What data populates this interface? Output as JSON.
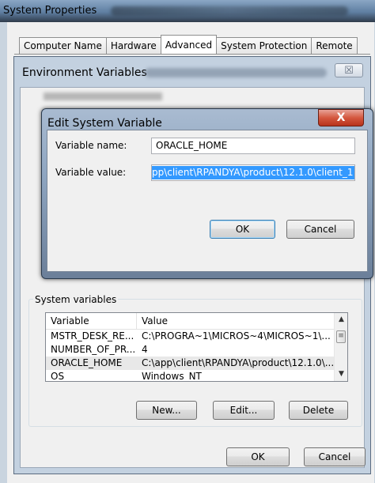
{
  "system_properties": {
    "title": "System Properties",
    "tabs": [
      "Computer Name",
      "Hardware",
      "Advanced",
      "System Protection",
      "Remote"
    ],
    "active_tab": "Advanced",
    "ok_label": "OK",
    "cancel_label": "Cancel"
  },
  "env_vars": {
    "title": "Environment Variables",
    "close_glyph": "☒",
    "system_variables_label": "System variables",
    "columns": [
      "Variable",
      "Value"
    ],
    "rows": [
      {
        "variable": "MSTR_DESK_RE...",
        "value": "C:\\PROGRA~1\\MICROS~4\\MICROS~1\\..."
      },
      {
        "variable": "NUMBER_OF_PR...",
        "value": "4"
      },
      {
        "variable": "ORACLE_HOME",
        "value": "C:\\app\\client\\RPANDYA\\product\\12.1.0\\..."
      },
      {
        "variable": "OS",
        "value": "Windows_NT"
      }
    ],
    "selected_row": "ORACLE_HOME",
    "new_label": "New...",
    "edit_label": "Edit...",
    "delete_label": "Delete"
  },
  "edit_dialog": {
    "title": "Edit System Variable",
    "close_glyph": "X",
    "name_label": "Variable name:",
    "name_value": "ORACLE_HOME",
    "value_label": "Variable value:",
    "value_value": "pp\\client\\RPANDYA\\product\\12.1.0\\client_1",
    "ok_label": "OK",
    "cancel_label": "Cancel"
  },
  "colors": {
    "selection_highlight": "#3399ff",
    "close_button_red": "#d4583f",
    "window_frame": "#c3d1e0"
  }
}
